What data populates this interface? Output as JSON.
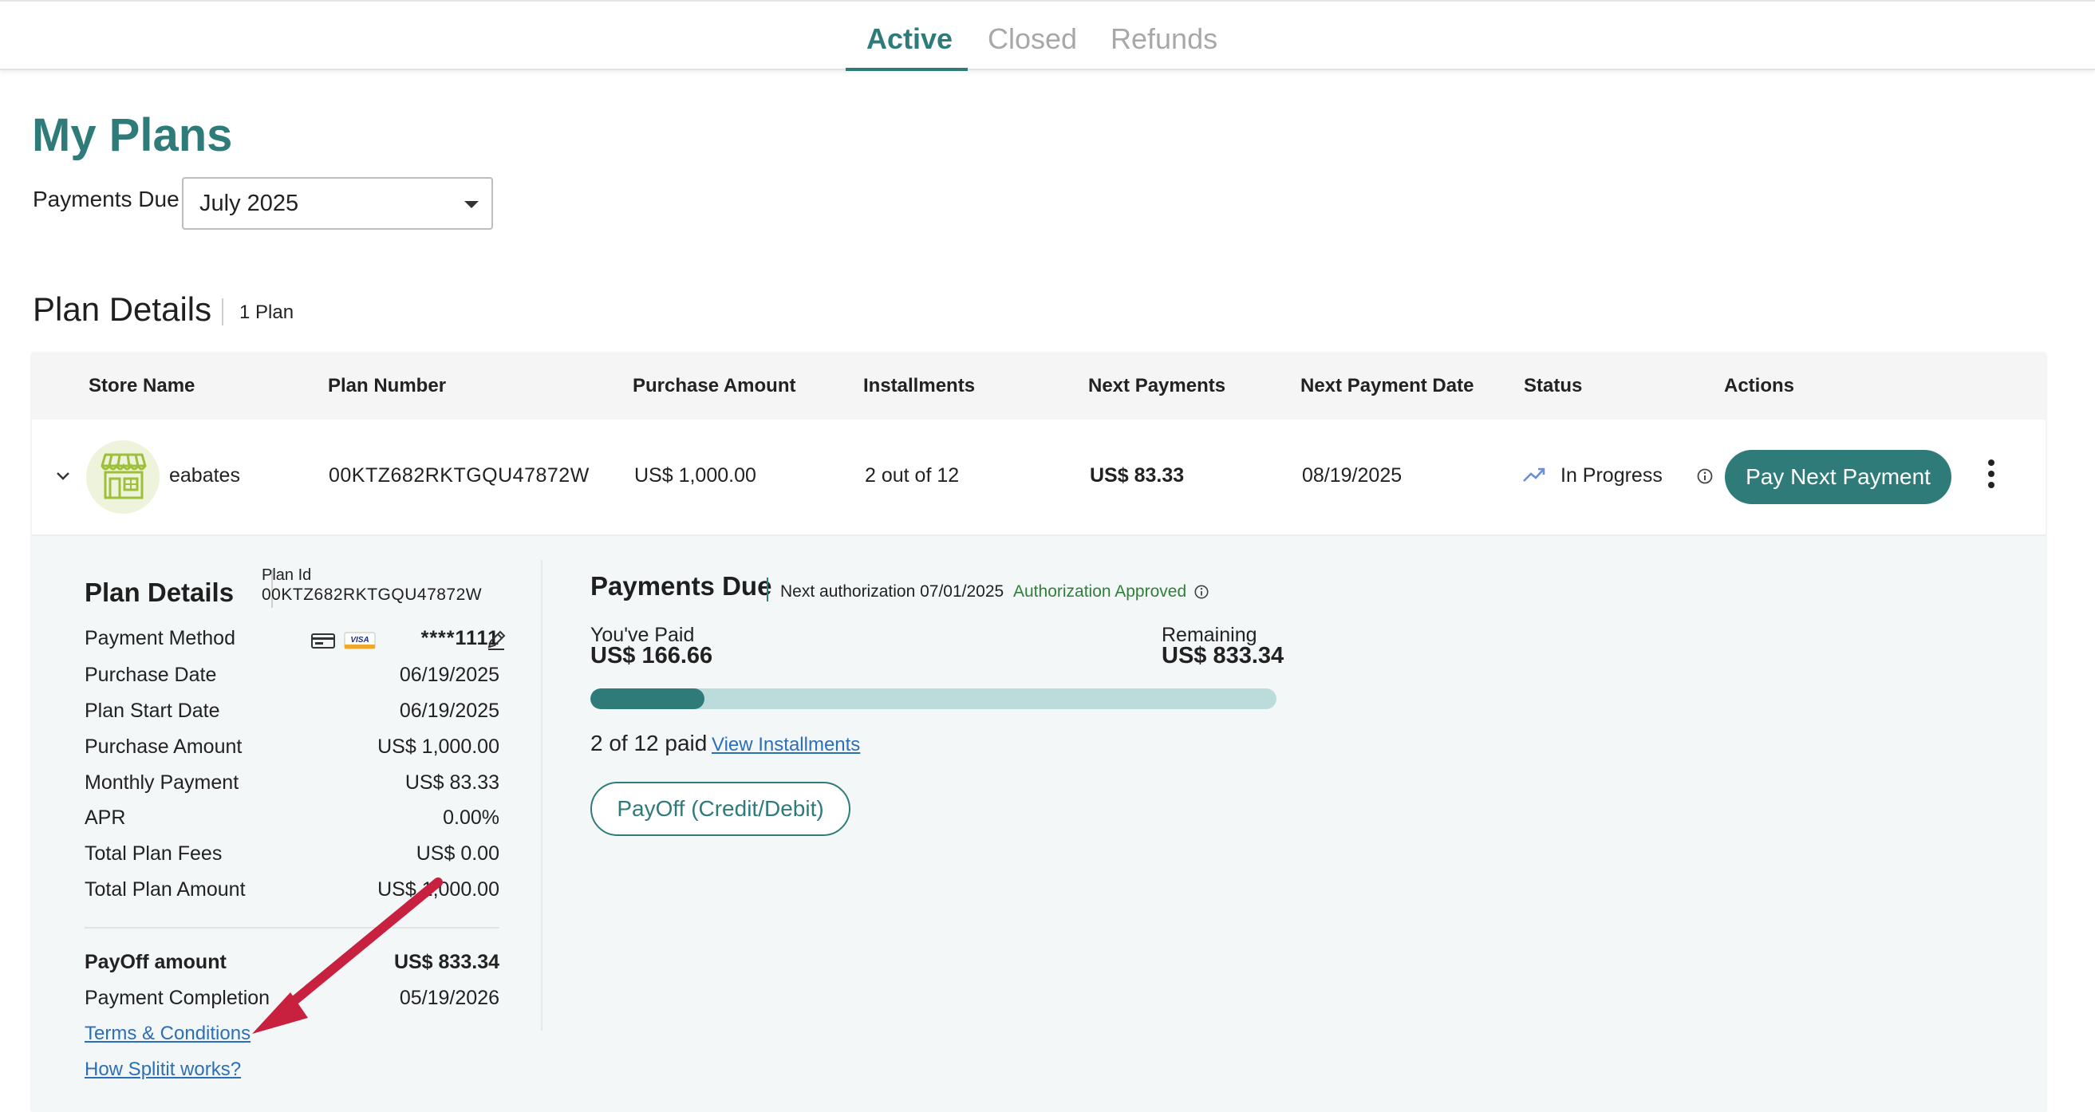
{
  "tabs": [
    {
      "label": "Active",
      "active": true
    },
    {
      "label": "Closed",
      "active": false
    },
    {
      "label": "Refunds",
      "active": false
    }
  ],
  "page_title": "My Plans",
  "payments_due": {
    "label": "Payments Due",
    "selected": "July 2025"
  },
  "plan_section": {
    "title": "Plan Details",
    "count": "1 Plan"
  },
  "table": {
    "headers": [
      "Store Name",
      "Plan Number",
      "Purchase Amount",
      "Installments",
      "Next Payments",
      "Next Payment Date",
      "Status",
      "Actions"
    ],
    "row": {
      "store": "eabates",
      "plan_number": "00KTZ682RKTGQU47872W",
      "purchase_amount": "US$ 1,000.00",
      "installments": "2 out of 12",
      "next_payment": "US$ 83.33",
      "next_payment_date": "08/19/2025",
      "status": "In Progress",
      "action_label": "Pay Next Payment"
    }
  },
  "details": {
    "title": "Plan Details",
    "plan_id_label": "Plan Id",
    "plan_id": "00KTZ682RKTGQU47872W",
    "payment_method_label": "Payment Method",
    "card_brand": "VISA",
    "card_masked": "****1111",
    "rows": [
      {
        "label": "Purchase Date",
        "value": "06/19/2025"
      },
      {
        "label": "Plan Start Date",
        "value": "06/19/2025"
      },
      {
        "label": "Purchase Amount",
        "value": "US$ 1,000.00"
      },
      {
        "label": "Monthly Payment",
        "value": "US$ 83.33"
      },
      {
        "label": "APR",
        "value": "0.00%"
      },
      {
        "label": "Total Plan Fees",
        "value": "US$ 0.00"
      },
      {
        "label": "Total Plan Amount",
        "value": "US$ 1,000.00"
      }
    ],
    "payoff": {
      "label": "PayOff amount",
      "value": "US$ 833.34"
    },
    "completion": {
      "label": "Payment Completion",
      "value": "05/19/2026"
    },
    "terms_link": "Terms & Conditions",
    "how_link": "How Splitit works?"
  },
  "payments": {
    "title": "Payments Due",
    "next_auth": "Next authorization 07/01/2025",
    "auth_status": "Authorization Approved",
    "paid_label": "You've Paid",
    "paid_value": "US$ 166.66",
    "remaining_label": "Remaining",
    "remaining_value": "US$ 833.34",
    "progress_fraction": 0.1667,
    "count_text": "2 of 12 paid",
    "view_link": "View Installments",
    "payoff_button": "PayOff (Credit/Debit)"
  },
  "colors": {
    "brand": "#2f7b7a",
    "progress_track": "#bcdcdc",
    "link": "#2c6fb8",
    "approved": "#2f7f3a",
    "annotation_arrow": "#c8203f"
  }
}
